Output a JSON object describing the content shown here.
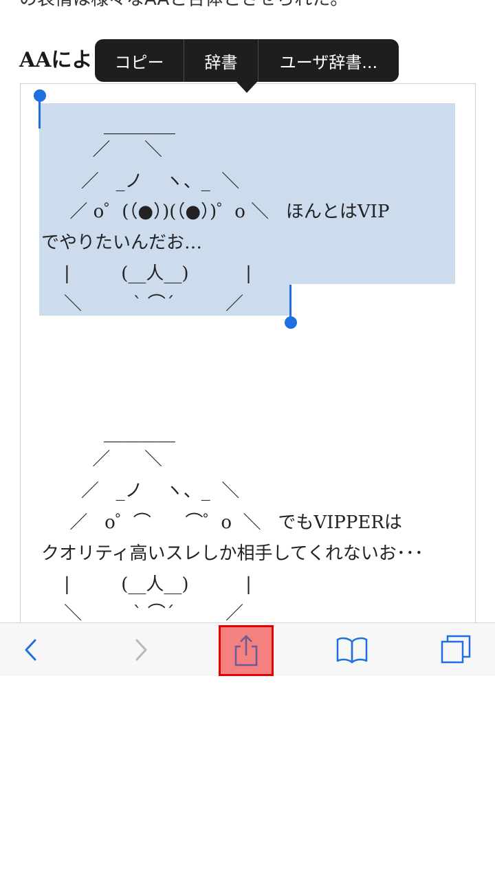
{
  "article": {
    "top_text": "の表情は様々なAAと合体とさせられた。",
    "heading": "AAによ"
  },
  "context_menu": {
    "items": [
      "コピー",
      "辞書",
      "ユーザ辞書..."
    ]
  },
  "aa_block_1": {
    "lines": [
      "           ＿＿＿＿",
      "         ／      ＼",
      "       ／   _ノ    ヽ、_  ＼",
      "     ／ o゜(（●）)(（●）)゜o ＼   ほんとはVIP",
      "でやりたいんだお…",
      "    |         (__人__)          |",
      "    ＼         ` ⌒´         ／"
    ]
  },
  "aa_block_2": {
    "lines": [
      "           ＿＿＿＿",
      "         ／      ＼",
      "       ／   _ノ    ヽ、_  ＼",
      "     ／   o゜⌒      ⌒゜o  ＼   でもVIPPERは",
      "クオリティ高いスレしか相手してくれないお･･･",
      "    |         (__人__)          |",
      "    ＼         ` ⌒´         ／"
    ]
  },
  "toolbar": {
    "icons": [
      "chevron-left-icon",
      "chevron-right-icon",
      "share-icon",
      "bookmarks-icon",
      "tabs-icon"
    ],
    "colors": {
      "active": "#1f6fe0",
      "disabled": "#b8b8b8",
      "highlight_fill": "#f58080",
      "highlight_border": "#e00000"
    }
  }
}
